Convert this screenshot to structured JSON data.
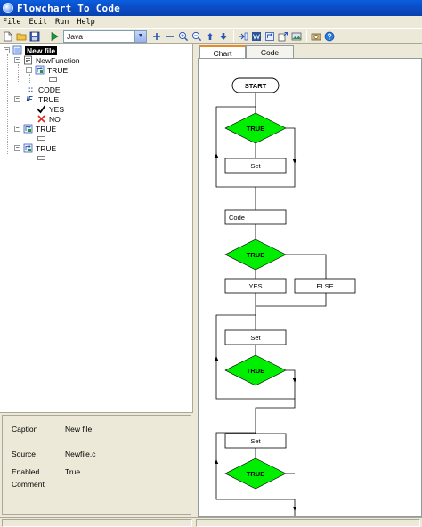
{
  "window": {
    "title": "Flowchart To Code"
  },
  "menu": [
    "File",
    "Edit",
    "Run",
    "Help"
  ],
  "toolbar": {
    "language": "Java",
    "language_arrow": "▼"
  },
  "tree": {
    "root": "New file",
    "function": "NewFunction",
    "nodes": {
      "loop1": "TRUE",
      "code": "CODE",
      "if": "TRUE",
      "yes": "YES",
      "no": "NO",
      "loop2": "TRUE",
      "loop3": "TRUE"
    },
    "if_tag": "IF",
    "code_tag": "::"
  },
  "properties": [
    {
      "key": "Caption",
      "value": "New file"
    },
    {
      "key": "Source",
      "value": "Newfile.c"
    },
    {
      "key": "Enabled",
      "value": "True"
    },
    {
      "key": "Comment",
      "value": ""
    }
  ],
  "tabs": [
    {
      "label": "Chart",
      "active": true
    },
    {
      "label": "Code",
      "active": false
    }
  ],
  "flowchart": {
    "start": "START",
    "decision_label": "TRUE",
    "set_label": "Set",
    "code_label": "Code",
    "yes_label": "YES",
    "else_label": "ELSE",
    "decision_color": "#00EE00"
  }
}
